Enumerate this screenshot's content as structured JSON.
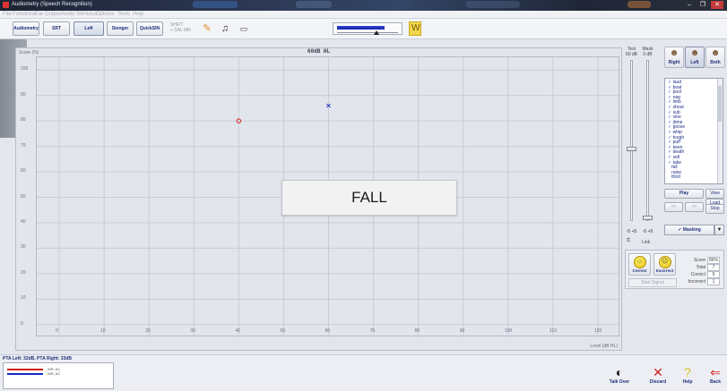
{
  "window": {
    "title": "Audiometry (Speech Recognition)",
    "controls": [
      "–",
      "❐",
      "✕"
    ]
  },
  "menu": [
    "File",
    "Functions",
    "Ear",
    "Output",
    "Audio",
    "Stimulus",
    "Options",
    "Tools",
    "Help"
  ],
  "toolbar": {
    "tabs": [
      {
        "label": "Audiometry",
        "active": false
      },
      {
        "label": "SRT",
        "active": false
      },
      {
        "label": "Left",
        "active": true
      },
      {
        "label": "Stenger",
        "active": false
      },
      {
        "label": "QuickSIN",
        "active": false
      }
    ],
    "shift_label": "SHIFT",
    "shift_sub": "+ SAL MR",
    "tools": [
      "edit-note-icon",
      "headphones-icon",
      "speaker-icon"
    ],
    "level_fraction": 0.78,
    "pointer_fraction": 0.64
  },
  "graph": {
    "title": "60dB HL",
    "y_axis_title": "Score (%)",
    "x_axis_title": "Level (dB HL)",
    "current_word": "FALL"
  },
  "chart_data": {
    "type": "scatter",
    "title": "60dB HL",
    "ylabel": "Score (%)",
    "xlabel": "Level (dB HL)",
    "xlim": [
      -5,
      125
    ],
    "ylim": [
      -5,
      105
    ],
    "x_ticks": [
      0,
      10,
      20,
      30,
      40,
      50,
      60,
      70,
      80,
      90,
      100,
      110,
      120
    ],
    "y_ticks": [
      0,
      10,
      20,
      30,
      40,
      50,
      60,
      70,
      80,
      90,
      100
    ],
    "grid": true,
    "series": [
      {
        "marker": "circle",
        "color": "#d02020",
        "points": [
          [
            40,
            80
          ]
        ]
      },
      {
        "marker": "x",
        "color": "#2030c0",
        "points": [
          [
            60,
            86
          ]
        ]
      }
    ]
  },
  "sliders": {
    "test": {
      "header": "Test",
      "value": "60 dB",
      "foot_minus": "-5",
      "foot_plus": "+5",
      "level_fraction": 0.55
    },
    "mask": {
      "header": "Mask",
      "value": "0 dB",
      "foot_minus": "-5",
      "foot_plus": "+5",
      "level_fraction": 0.98
    },
    "link_label": "Link"
  },
  "ears": [
    {
      "label": "Right",
      "active": false
    },
    {
      "label": "Left",
      "active": true
    },
    {
      "label": "Both",
      "active": false
    }
  ],
  "words": [
    {
      "text": "laud",
      "checked": true
    },
    {
      "text": "boat",
      "checked": true
    },
    {
      "text": "pool",
      "checked": true
    },
    {
      "text": "nag",
      "checked": true
    },
    {
      "text": "limb",
      "checked": true
    },
    {
      "text": "shout",
      "checked": true
    },
    {
      "text": "sub",
      "checked": true
    },
    {
      "text": "vine",
      "checked": true
    },
    {
      "text": "dime",
      "checked": true
    },
    {
      "text": "goose",
      "checked": true
    },
    {
      "text": "whip",
      "checked": true
    },
    {
      "text": "tough",
      "checked": true
    },
    {
      "text": "puff",
      "checked": true
    },
    {
      "text": "keen",
      "checked": true
    },
    {
      "text": "death",
      "checked": true
    },
    {
      "text": "sell",
      "checked": true
    },
    {
      "text": "take",
      "checked": true
    },
    {
      "text": "fall",
      "checked": false
    },
    {
      "text": "raise",
      "checked": false
    },
    {
      "text": "third",
      "checked": false
    }
  ],
  "playback": {
    "play": "Play",
    "view": "View",
    "load": "Load",
    "stop": "Stop",
    "prev": "<<",
    "next": ">>"
  },
  "masking": {
    "label": "Masking",
    "check": "✓"
  },
  "scoring": {
    "correct": "Correct",
    "incorrect": "Incorrect",
    "start_signal": "Start Signal",
    "score_label": "Score",
    "score_value": "86%",
    "total_label": "Total",
    "total_value": "7",
    "correct_label": "Correct",
    "correct_value": "6",
    "incorrect_label": "Incorrect",
    "incorrect_value": "1"
  },
  "pta": {
    "text": "PTA Left: 32dB, PTA Right: 33dB",
    "legend": [
      {
        "label": "WR, AC",
        "color": "#d01818"
      },
      {
        "label": "WR, AC",
        "color": "#1828c8"
      }
    ]
  },
  "bottom": [
    {
      "label": "Talk Over",
      "icon": "microphone-icon",
      "glyph": "◐",
      "color": "#222"
    },
    {
      "label": "Discard",
      "icon": "discard-x-icon",
      "glyph": "✕",
      "color": "#d02020"
    },
    {
      "label": "Help",
      "icon": "help-icon",
      "glyph": "?",
      "color": "#d6c21a"
    },
    {
      "label": "Back",
      "icon": "back-arrow-icon",
      "glyph": "⇐",
      "color": "#d62a2a"
    }
  ]
}
